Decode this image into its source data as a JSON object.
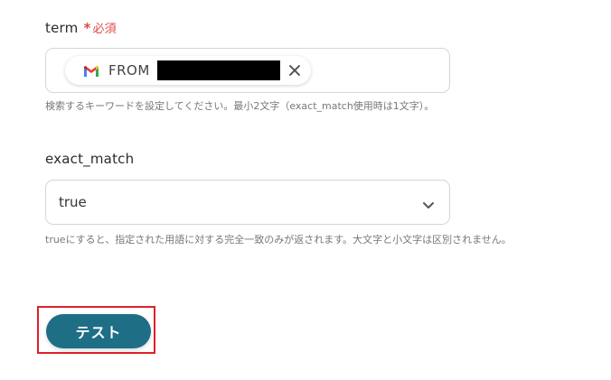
{
  "term_field": {
    "label": "term",
    "required_mark": "*",
    "required_text": "必須",
    "chip": {
      "icon": "gmail-icon",
      "text": "FROM",
      "remove_icon": "close-icon"
    },
    "help": "検索するキーワードを設定してください。最小2文字（exact_match使用時は1文字）。"
  },
  "exact_match_field": {
    "label": "exact_match",
    "selected_value": "true",
    "dropdown_icon": "chevron-down-icon",
    "help": "trueにすると、指定された用語に対する完全一致のみが返されます。大文字と小文字は区別されません。"
  },
  "actions": {
    "test_label": "テスト"
  },
  "colors": {
    "required": "#e04848",
    "test_button": "#1e6e86",
    "highlight_border": "#e0202a"
  }
}
